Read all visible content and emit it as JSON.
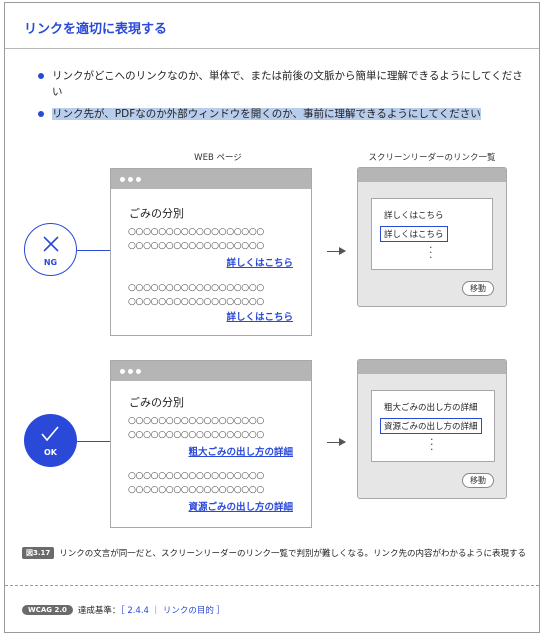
{
  "title": "リンクを適切に表現する",
  "bullets": [
    "リンクがどこへのリンクなのか、単体で、または前後の文脈から簡単に理解できるようにしてください",
    "リンク先が、PDFなのか外部ウィンドウを開くのか、事前に理解できるようにしてください"
  ],
  "captions": {
    "web_page": "WEB ページ",
    "screen_reader": "スクリーンリーダーのリンク一覧"
  },
  "ng": {
    "badge": "NG",
    "page_heading": "ごみの分別",
    "circles": "○○○○○○○○○○○○○○○○○○",
    "links": [
      "詳しくはこちら",
      "詳しくはこちら"
    ],
    "sr_items": [
      "詳しくはこちら",
      "詳しくはこちら"
    ],
    "move_button": "移動"
  },
  "ok": {
    "badge": "OK",
    "page_heading": "ごみの分別",
    "circles": "○○○○○○○○○○○○○○○○○○",
    "links": [
      "粗大ごみの出し方の詳細",
      "資源ごみの出し方の詳細"
    ],
    "sr_items": [
      "粗大ごみの出し方の詳細",
      "資源ごみの出し方の詳細"
    ],
    "move_button": "移動"
  },
  "figure": {
    "tag": "図3.17",
    "caption": "リンクの文言が同一だと、スクリーンリーダーのリンク一覧で判別が難しくなる。リンク先の内容がわかるように表現する"
  },
  "footer": {
    "tag": "WCAG 2.0",
    "label": "達成基準：",
    "ref": "［ 2.4.4 ｜ リンクの目的 ］"
  },
  "colors": {
    "accent": "#2a49d9",
    "highlight": "#b8ccec",
    "window_bar": "#b5b5b5"
  }
}
